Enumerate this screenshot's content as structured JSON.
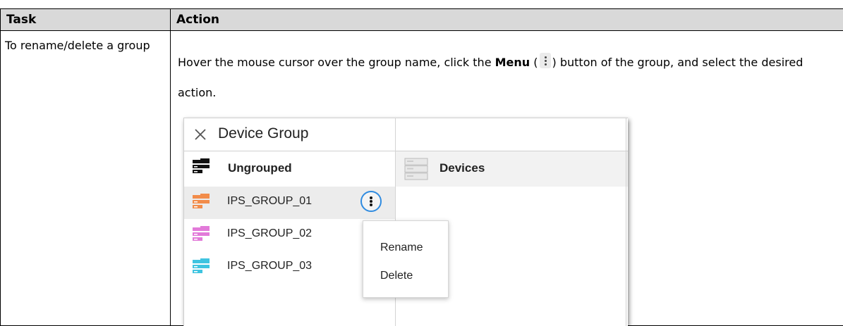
{
  "table": {
    "header_task": "Task",
    "header_action": "Action",
    "task": "To rename/delete a group",
    "action_prefix": "Hover the mouse cursor over the group name, click the ",
    "action_bold": "Menu",
    "action_mid": " (",
    "action_suffix": ") button of the group, and select the desired action."
  },
  "figure": {
    "title": "Device Group",
    "ungrouped_label": "Ungrouped",
    "devices_label": "Devices",
    "groups": [
      {
        "label": "IPS_GROUP_01",
        "color": "#f28c4a"
      },
      {
        "label": "IPS_GROUP_02",
        "color": "#e27ad9"
      },
      {
        "label": "IPS_GROUP_03",
        "color": "#3fc4e0"
      }
    ],
    "menu_items": [
      "Rename",
      "Delete"
    ],
    "accent_color": "#2f8be0"
  }
}
